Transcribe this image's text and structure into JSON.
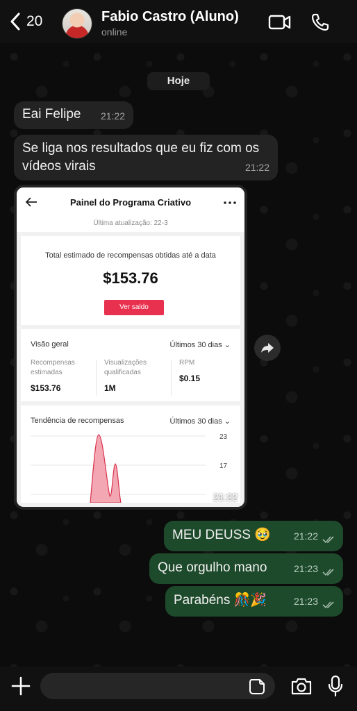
{
  "header": {
    "back_count": "20",
    "contact_name": "Fabio Castro (Aluno)",
    "status": "online"
  },
  "date_chip": "Hoje",
  "messages": [
    {
      "direction": "in",
      "text": "Eai Felipe",
      "time": "21:22"
    },
    {
      "direction": "in",
      "text": "Se liga nos resultados que eu fiz com os vídeos virais",
      "time": "21:22"
    },
    {
      "direction": "in",
      "type": "image",
      "time": "21:22"
    },
    {
      "direction": "out",
      "text": "MEU DEUSS 🥹",
      "time": "21:22"
    },
    {
      "direction": "out",
      "text": "Que orgulho mano",
      "time": "21:23"
    },
    {
      "direction": "out",
      "text": "Parabéns 🎊🎉",
      "time": "21:23"
    }
  ],
  "screenshot": {
    "title": "Painel do Programa Criativo",
    "updated": "Última atualização: 22-3",
    "total_label": "Total estimado de recompensas obtidas até a data",
    "total_amount": "$153.76",
    "button": "Ver saldo",
    "overview_title": "Visão geral",
    "overview_range": "Últimos 30 dias",
    "metrics": [
      {
        "label": "Recompensas estimadas",
        "value": "$153.76"
      },
      {
        "label": "Visualizações qualificadas",
        "value": "1M"
      },
      {
        "label": "RPM",
        "value": "$0.15"
      }
    ],
    "trend_title": "Tendência de recompensas",
    "trend_range": "Últimos 30 dias",
    "trend_ticks": [
      "23",
      "17"
    ],
    "trend_accent": "#e8304f"
  },
  "colors": {
    "incoming_bubble": "#232323",
    "outgoing_bubble": "#1e4a2c",
    "read_ticks": "#9fb9a8"
  },
  "icons": [
    "back-chevron-icon",
    "video-call-icon",
    "phone-icon",
    "forward-icon",
    "plus-icon",
    "sticker-icon",
    "camera-icon",
    "microphone-icon",
    "double-check-icon"
  ]
}
